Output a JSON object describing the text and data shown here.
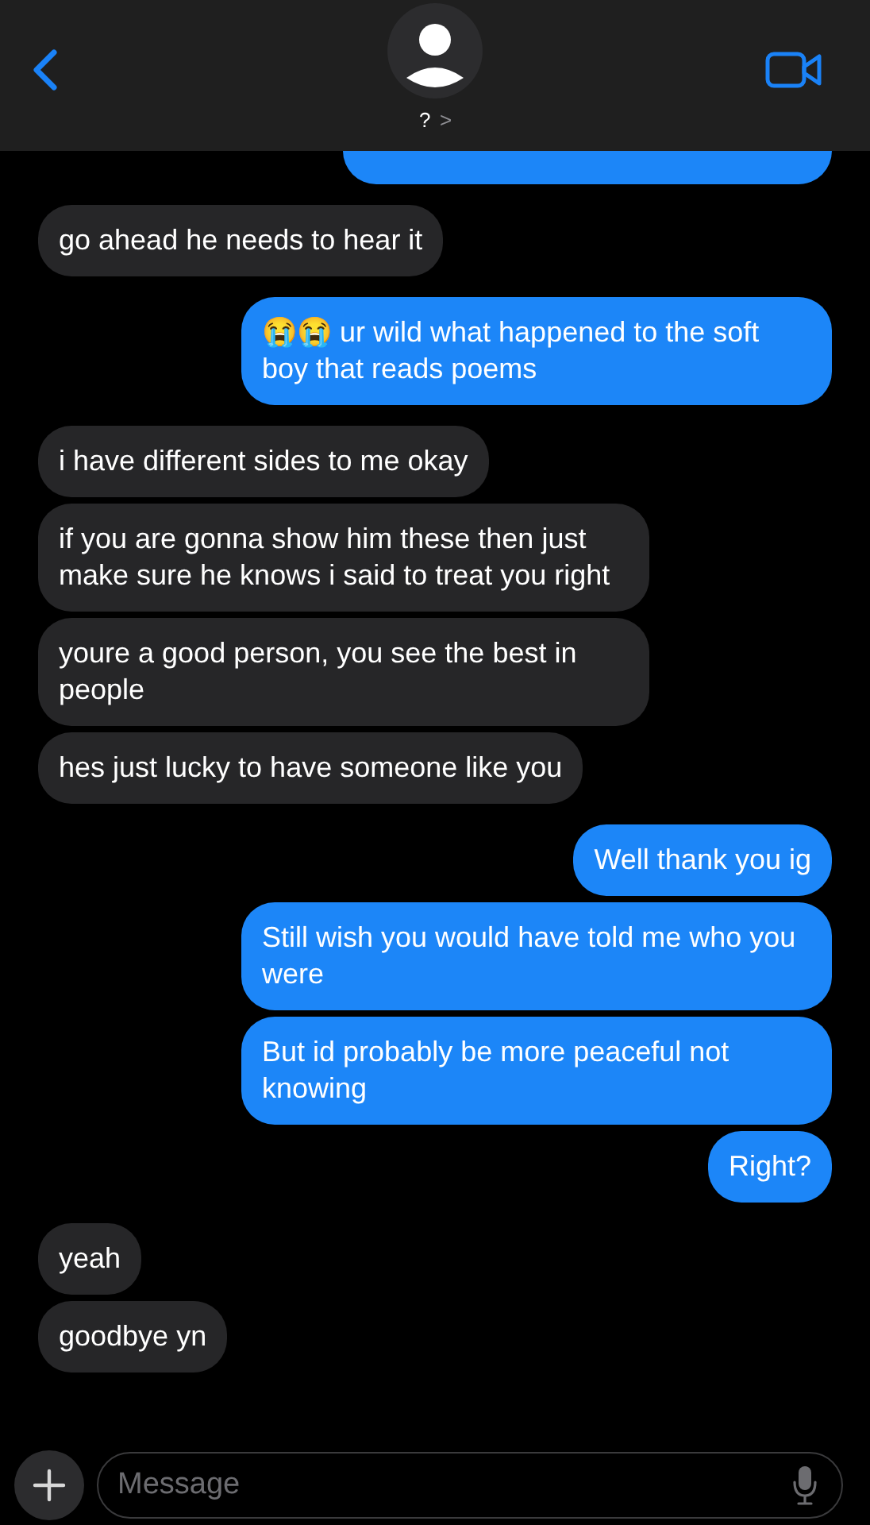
{
  "header": {
    "contact_name": "?",
    "chevron": ">"
  },
  "messages": [
    {
      "kind": "sent"
    },
    {
      "kind": "received",
      "text": "go ahead he needs to hear it"
    },
    {
      "kind": "sent",
      "text": "😭😭 ur wild what happened to the soft boy that reads poems"
    },
    {
      "kind": "received",
      "text": "i have different sides to me okay"
    },
    {
      "kind": "received",
      "text": "if you are gonna show him these then just make sure he knows i said to treat you right"
    },
    {
      "kind": "received",
      "text": "youre a good person, you see the best in people"
    },
    {
      "kind": "received",
      "text": "hes just lucky to have someone like you"
    },
    {
      "kind": "sent",
      "text": "Well thank you ig"
    },
    {
      "kind": "sent",
      "text": "Still wish you would have told me who you were"
    },
    {
      "kind": "sent",
      "text": "But id probably be more peaceful not knowing"
    },
    {
      "kind": "sent",
      "text": "Right?"
    },
    {
      "kind": "received",
      "text": "yeah"
    },
    {
      "kind": "received",
      "text": "goodbye yn"
    }
  ],
  "composer": {
    "placeholder": "Message"
  }
}
